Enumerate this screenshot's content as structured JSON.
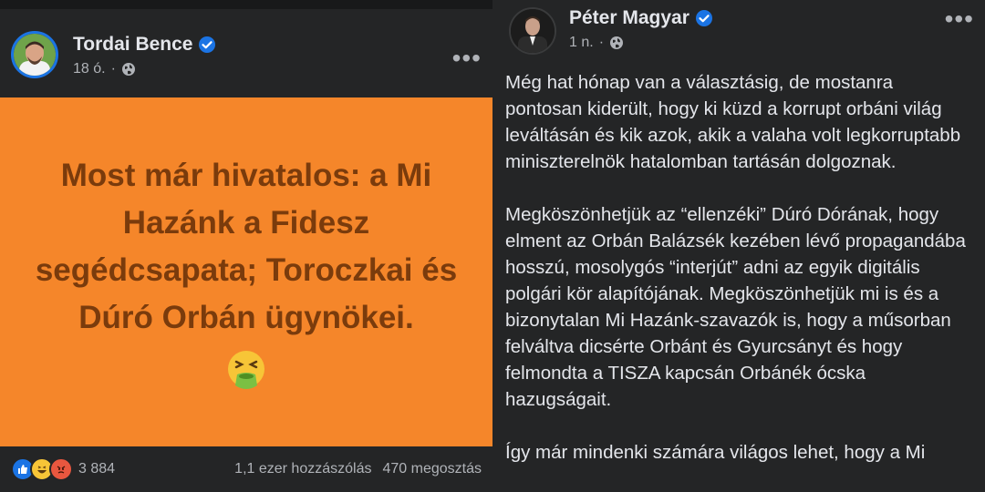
{
  "left_post": {
    "author": "Tordai Bence",
    "time": "18 ó.",
    "banner_text": "Most már hivatalos: a Mi Hazánk a Fidesz segédcsapata; Toroczkai és Dúró Orbán ügynökei.",
    "reaction_count": "3 884",
    "comments": "1,1 ezer hozzászólás",
    "shares": "470 megosztás",
    "banner_color": "#f5862a",
    "icons": [
      "verified-badge-icon",
      "globe-icon",
      "more-options-icon",
      "nauseated-face-emoji",
      "like-reaction-icon",
      "haha-reaction-icon",
      "angry-reaction-icon"
    ]
  },
  "right_post": {
    "author": "Péter Magyar",
    "time": "1 n.",
    "paragraphs": [
      "Még hat hónap van a választásig, de mostanra pontosan kiderült, hogy ki küzd a korrupt orbáni világ leváltásán és kik azok, akik a valaha volt legkorruptabb miniszterelnök hatalomban tartásán dolgoznak.",
      "Megköszönhetjük az “ellenzéki” Dúró Dórának, hogy elment az Orbán Balázsék kezében lévő propagandába hosszú, mosolygós “interjút” adni az egyik digitális polgári kör alapítójának. Megköszönhetjük mi is és a bizonytalan Mi Hazánk-szavazók is, hogy a műsorban felváltva dicsérte Orbánt és Gyurcsányt és hogy felmondta a TISZA kapcsán Orbánék ócska hazugságait.",
      "Így már mindenki számára világos lehet, hogy a Mi"
    ]
  },
  "colors": {
    "background": "#242526",
    "accent": "#1b74e4",
    "secondary_text": "#b0b3b8"
  }
}
